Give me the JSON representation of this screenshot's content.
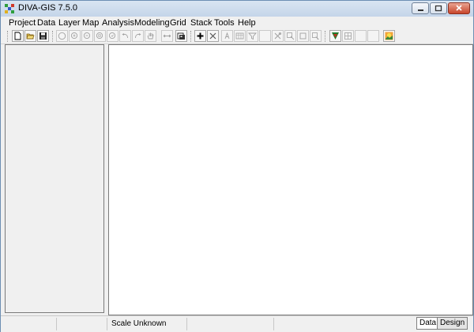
{
  "window": {
    "title": "DIVA-GIS 7.5.0"
  },
  "menu": [
    "Project",
    "Data",
    "Layer",
    "Map",
    "Analysis",
    "Modeling",
    "Grid",
    "Stack",
    "Tools",
    "Help"
  ],
  "status": {
    "scale": "Scale Unknown"
  },
  "tabs": {
    "data": "Data",
    "design": "Design"
  }
}
